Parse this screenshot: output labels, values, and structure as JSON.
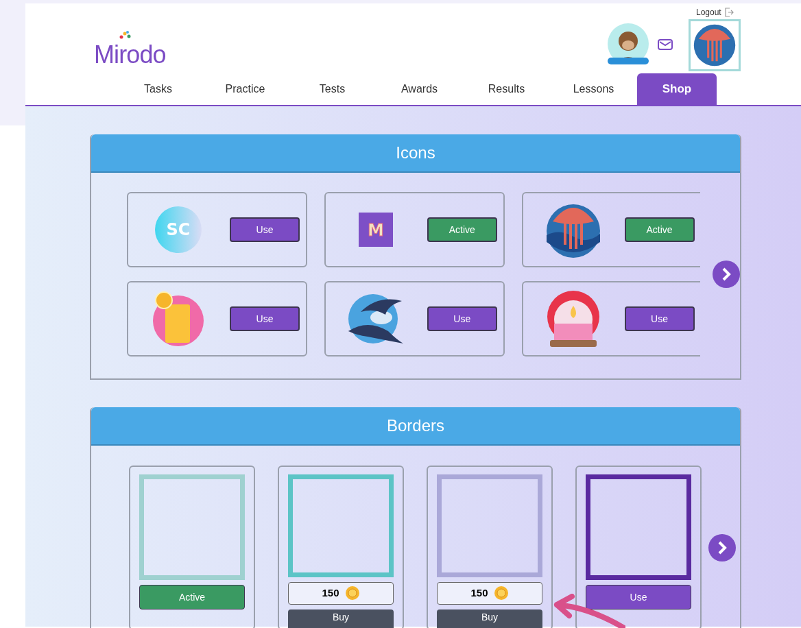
{
  "header": {
    "logo": "Mirodo",
    "logout": "Logout"
  },
  "nav": [
    {
      "label": "Tasks",
      "selected": false
    },
    {
      "label": "Practice",
      "selected": false
    },
    {
      "label": "Tests",
      "selected": false
    },
    {
      "label": "Awards",
      "selected": false
    },
    {
      "label": "Results",
      "selected": false
    },
    {
      "label": "Lessons",
      "selected": false
    },
    {
      "label": "Shop",
      "selected": true
    }
  ],
  "icons": {
    "title": "Icons",
    "items": [
      {
        "kind": "gradient-circle",
        "glyph": "SC",
        "button": "Use",
        "active": false
      },
      {
        "kind": "letter-tile",
        "glyph": "M",
        "button": "Active",
        "active": true
      },
      {
        "kind": "jellyfish",
        "button": "Active",
        "active": true
      },
      {
        "kind": "lemonade",
        "button": "Use",
        "active": false
      },
      {
        "kind": "bats",
        "button": "Use",
        "active": false
      },
      {
        "kind": "candle",
        "button": "Use",
        "active": false
      }
    ]
  },
  "borders": {
    "title": "Borders",
    "items": [
      {
        "kind": "owned",
        "color": "#9fd1d0",
        "button": "Active",
        "active": true
      },
      {
        "kind": "for_sale",
        "color": "#5cc4c6",
        "price": "150",
        "buy": "Buy"
      },
      {
        "kind": "for_sale",
        "color": "#aaa8d8",
        "price": "150",
        "buy": "Buy"
      },
      {
        "kind": "owned",
        "color": "#5a2aa0",
        "button": "Use",
        "active": false
      }
    ]
  }
}
